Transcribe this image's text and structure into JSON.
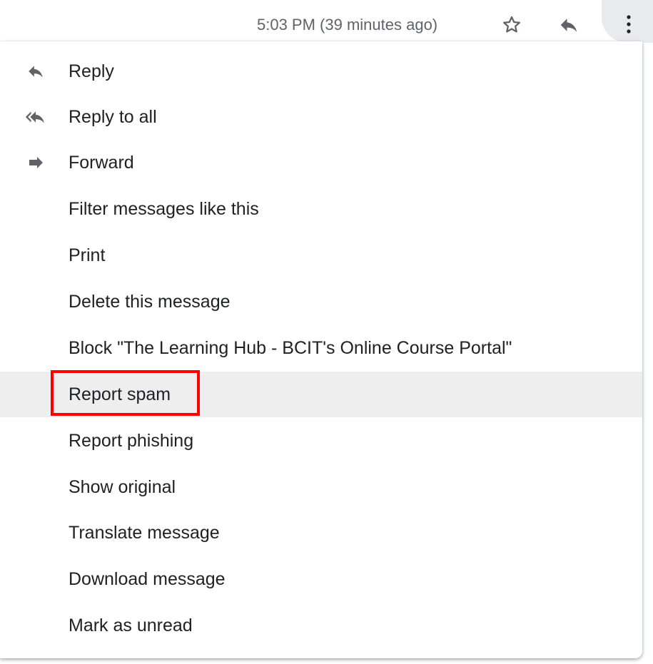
{
  "header": {
    "timestamp": "5:03 PM (39 minutes ago)",
    "icons": [
      "star-icon",
      "reply-icon",
      "more-vert-icon"
    ]
  },
  "menu": {
    "items": [
      {
        "label": "Reply",
        "icon": "reply-icon"
      },
      {
        "label": "Reply to all",
        "icon": "reply-all-icon"
      },
      {
        "label": "Forward",
        "icon": "forward-icon"
      },
      {
        "label": "Filter messages like this"
      },
      {
        "label": "Print"
      },
      {
        "label": "Delete this message"
      },
      {
        "label": "Block \"The Learning Hub - BCIT's Online Course Portal\""
      },
      {
        "label": "Report spam",
        "highlighted": true
      },
      {
        "label": "Report phishing"
      },
      {
        "label": "Show original"
      },
      {
        "label": "Translate message"
      },
      {
        "label": "Download message"
      },
      {
        "label": "Mark as unread"
      }
    ]
  },
  "colors": {
    "highlight_border": "#ff0000",
    "hover_background": "#eeeeee",
    "text": "#202124",
    "icon": "#5f6368"
  }
}
